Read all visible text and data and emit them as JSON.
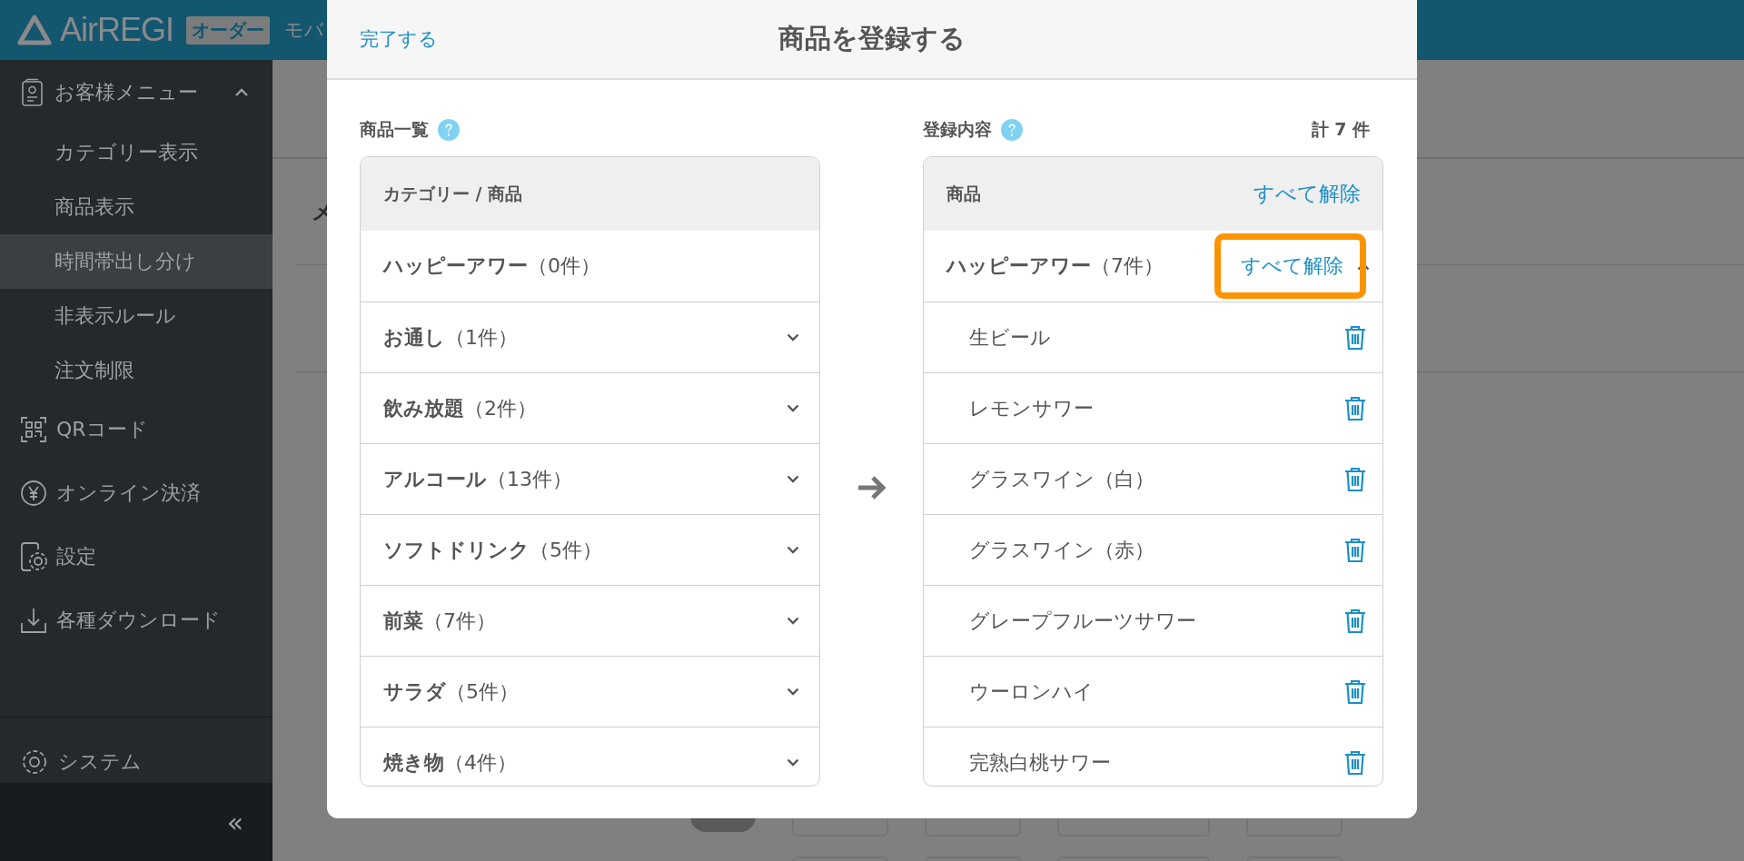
{
  "header": {
    "logo": "AirREGI",
    "badge": "オーダー",
    "subtitle": "モバ"
  },
  "sidebar": {
    "items": [
      {
        "label": "お客様メニュー",
        "kind": "card",
        "selected": false,
        "expanded": true,
        "children": [
          {
            "label": "カテゴリー表示",
            "selected": false
          },
          {
            "label": "商品表示",
            "selected": false
          },
          {
            "label": "時間帯出し分け",
            "selected": true
          },
          {
            "label": "非表示ルール",
            "selected": false
          },
          {
            "label": "注文制限",
            "selected": false
          }
        ]
      },
      {
        "label": "QRコード",
        "kind": "qr",
        "selected": false
      },
      {
        "label": "オンライン決済",
        "kind": "payment",
        "selected": false
      },
      {
        "label": "設定",
        "kind": "settings",
        "selected": false
      },
      {
        "label": "各種ダウンロード",
        "kind": "download",
        "selected": false
      }
    ],
    "footer_item": {
      "label": "システム",
      "kind": "system",
      "selected": false
    },
    "collapse": "«"
  },
  "page": {
    "rows": [
      "メ"
    ],
    "toggles": [
      {
        "on": false
      }
    ]
  },
  "dialog": {
    "done": "完了する",
    "title": "商品を登録する",
    "left": {
      "label": "商品一覧",
      "header": "カテゴリー / 商品",
      "categories": [
        {
          "text": "**ハッピーアワー**（0件）",
          "expandable": false
        },
        {
          "text": "**お通し**（1件）",
          "expandable": true
        },
        {
          "text": "**飲み放題**（2件）",
          "expandable": true
        },
        {
          "text": "**アルコール**（13件）",
          "expandable": true
        },
        {
          "text": "**ソフトドリンク**（5件）",
          "expandable": true
        },
        {
          "text": "**前菜**（7件）",
          "expandable": true
        },
        {
          "text": "**サラダ**（5件）",
          "expandable": true
        },
        {
          "text": "**焼き物**（4件）",
          "expandable": true
        }
      ]
    },
    "right": {
      "label": "登録内容",
      "total": "計 7 件",
      "header": "商品",
      "clear_all": "すべて解除",
      "group": {
        "text": "**ハッピーアワー**（7件）",
        "clear": "すべて解除",
        "highlighted": true,
        "expanded": true,
        "items": [
          "生ビール",
          "レモンサワー",
          "グラスワイン（白）",
          "グラスワイン（赤）",
          "グレープフルーツサワー",
          "ウーロンハイ",
          "完熟白桃サワー"
        ]
      }
    }
  }
}
